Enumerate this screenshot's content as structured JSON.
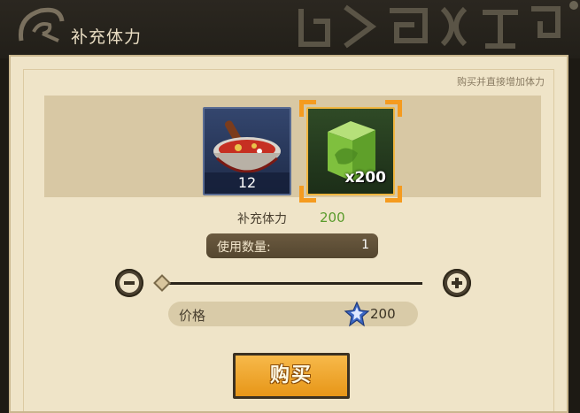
{
  "header": {
    "title": "补充体力",
    "logo_icon": "leaf-village-icon"
  },
  "hint": "购买并直接增加体力",
  "items": [
    {
      "icon": "stew-bowl-icon",
      "count": "12"
    },
    {
      "icon": "energy-cube-icon",
      "count": "x200",
      "selected": true
    }
  ],
  "stat": {
    "label": "补充体力",
    "value": "200"
  },
  "quantity": {
    "label": "使用数量:",
    "value": "1"
  },
  "slider": {
    "level": 0
  },
  "price": {
    "label": "价格",
    "value": "200",
    "currency_icon": "crystal-icon"
  },
  "buy_button": {
    "label": "购买"
  },
  "colors": {
    "accent": "#f59b1f",
    "button": "#f0a42e",
    "stat_value": "#5a9b2c"
  }
}
